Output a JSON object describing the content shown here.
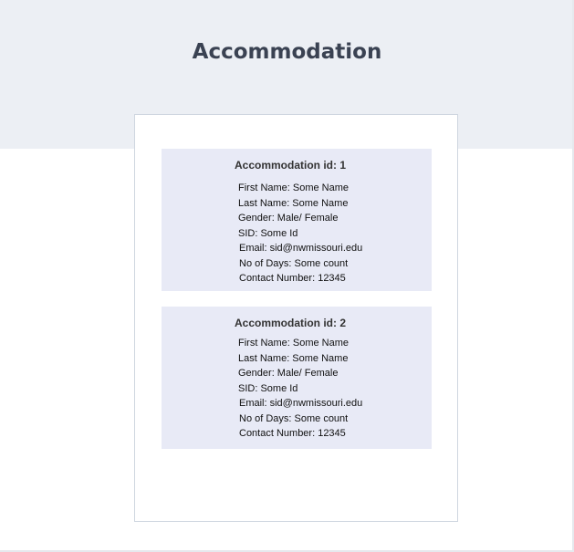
{
  "page": {
    "title": "Accommodation"
  },
  "accommodations": [
    {
      "heading": "Accommodation id: 1",
      "first_name": "First Name: Some Name",
      "last_name": "Last Name: Some Name",
      "gender": "Gender: Male/ Female",
      "sid": "SID: Some Id",
      "email": "Email: sid@nwmissouri.edu",
      "no_of_days": "No of Days: Some count",
      "contact_number": "Contact Number: 12345"
    },
    {
      "heading": "Accommodation id: 2",
      "first_name": "First Name: Some Name",
      "last_name": "Last Name: Some Name",
      "gender": "Gender: Male/ Female",
      "sid": "SID: Some Id",
      "email": "Email: sid@nwmissouri.edu",
      "no_of_days": "No of Days: Some count",
      "contact_number": "Contact Number: 12345"
    }
  ],
  "colors": {
    "header_background": "#eceff4",
    "title_text": "#3a4252",
    "entry_background": "#e8eaf6",
    "card_border": "#cfd6e0"
  }
}
